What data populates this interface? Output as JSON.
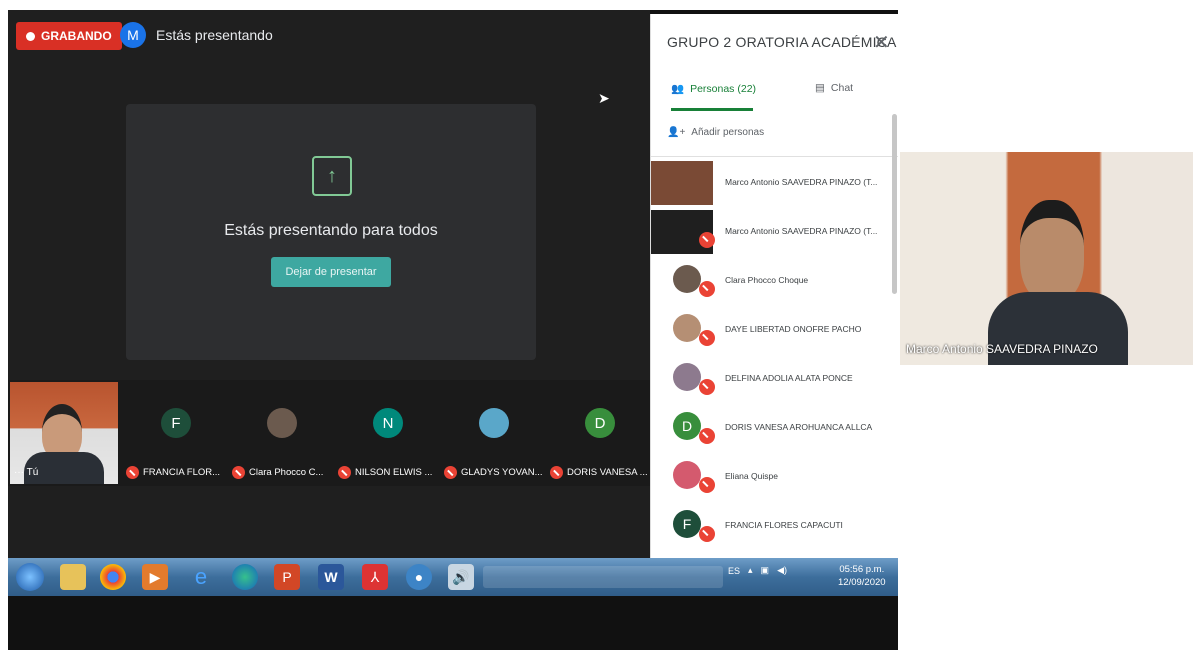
{
  "meet": {
    "recording_label": "GRABANDO",
    "presenter_initial": "M",
    "presenting_status": "Estás presentando",
    "present_card_title": "Estás presentando para todos",
    "stop_button": "Dejar de presentar"
  },
  "strip": {
    "self_label": "Tú",
    "tiles": [
      {
        "initial": "F",
        "name": "FRANCIA FLOR...",
        "color": "#1e4e3a"
      },
      {
        "initial": "",
        "name": "Clara Phocco C...",
        "color": "#6b5a4e"
      },
      {
        "initial": "N",
        "name": "NILSON ELWIS ...",
        "color": "#00897b"
      },
      {
        "initial": "",
        "name": "GLADYS YOVAN...",
        "color": "#5aa7c9"
      },
      {
        "initial": "D",
        "name": "DORIS VANESA ...",
        "color": "#388e3c"
      }
    ]
  },
  "panel": {
    "title": "GRUPO 2 ORATORIA ACADÉMICA",
    "tab_people": "Personas (22)",
    "tab_chat": "Chat",
    "add_people": "Añadir personas",
    "people": [
      {
        "name": "Marco Antonio SAAVEDRA PINAZO (T...",
        "initial": "",
        "color": "#3a3a3a"
      },
      {
        "name": "Marco Antonio SAAVEDRA PINAZO (T...",
        "initial": "",
        "color": "#1f1f1f"
      },
      {
        "name": "Clara Phocco Choque",
        "initial": "",
        "color": "#6b5a4e"
      },
      {
        "name": "DAYE LIBERTAD ONOFRE PACHO",
        "initial": "",
        "color": "#b58f74"
      },
      {
        "name": "DELFINA ADOLIA ALATA PONCE",
        "initial": "",
        "color": "#8d7a8e"
      },
      {
        "name": "DORIS VANESA AROHUANCA ALLCA",
        "initial": "D",
        "color": "#388e3c"
      },
      {
        "name": "Eliana Quispe",
        "initial": "",
        "color": "#d45a6e"
      },
      {
        "name": "FRANCIA FLORES CAPACUTI",
        "initial": "F",
        "color": "#1e4e3a"
      }
    ]
  },
  "taskbar": {
    "language": "ES",
    "time": "05:56 p.m.",
    "date": "12/09/2020"
  },
  "feed": {
    "name": "Marco Antonio SAAVEDRA PINAZO"
  }
}
